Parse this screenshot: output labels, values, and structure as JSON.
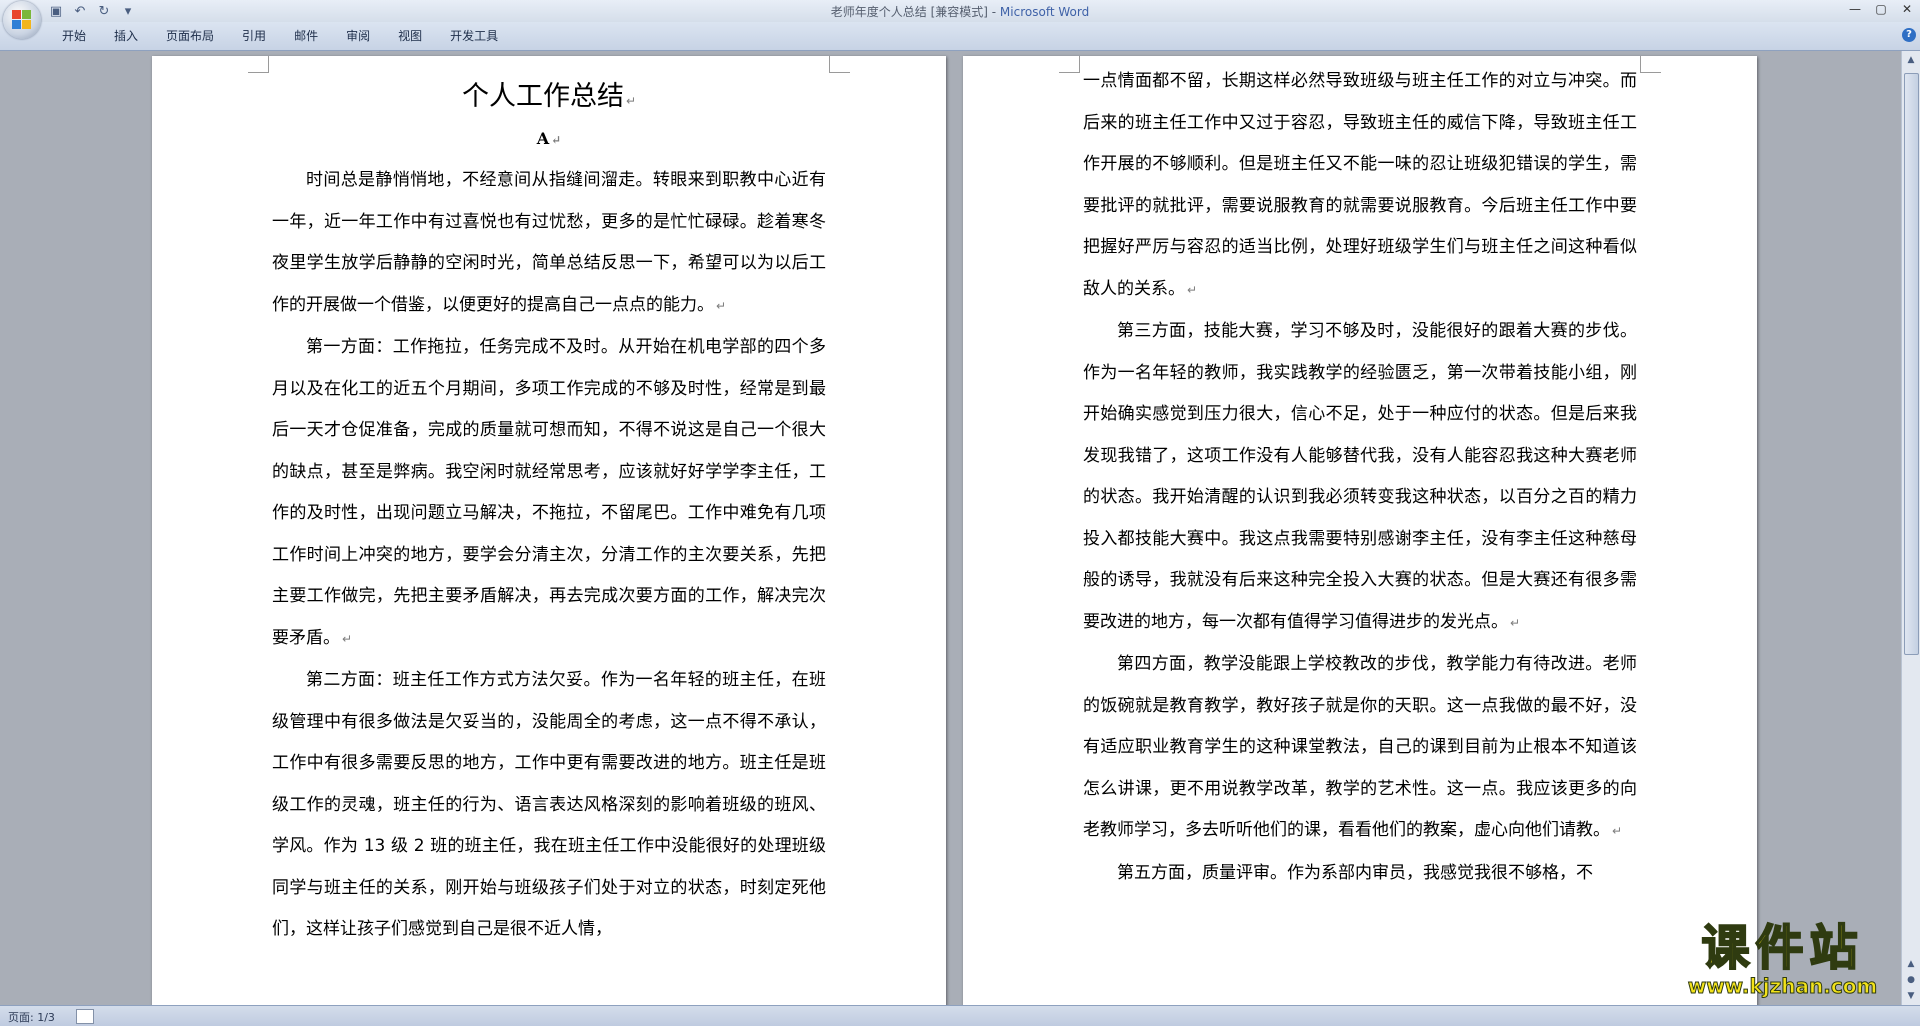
{
  "window": {
    "title": "老师年度个人总结 [兼容模式] - ",
    "app_name": "Microsoft Word",
    "minimize": "—",
    "maximize": "▢",
    "close": "✕"
  },
  "qat": {
    "save": "▣",
    "undo": "↶",
    "redo": "↻",
    "customize": "▾"
  },
  "ribbon": {
    "tabs": [
      "开始",
      "插入",
      "页面布局",
      "引用",
      "邮件",
      "审阅",
      "视图",
      "开发工具"
    ],
    "help": "?"
  },
  "page_left": {
    "title": "个人工作总结",
    "subtitle": "A",
    "paragraphs": [
      "时间总是静悄悄地，不经意间从指缝间溜走。转眼来到职教中心近有一年，近一年工作中有过喜悦也有过忧愁，更多的是忙忙碌碌。趁着寒冬夜里学生放学后静静的空闲时光，简单总结反思一下，希望可以为以后工作的开展做一个借鉴，以便更好的提高自己一点点的能力。",
      "第一方面：工作拖拉，任务完成不及时。从开始在机电学部的四个多月以及在化工的近五个月期间，多项工作完成的不够及时性，经常是到最后一天才仓促准备，完成的质量就可想而知，不得不说这是自己一个很大的缺点，甚至是弊病。我空闲时就经常思考，应该就好好学学李主任，工作的及时性，出现问题立马解决，不拖拉，不留尾巴。工作中难免有几项工作时间上冲突的地方，要学会分清主次，分清工作的主次要关系，先把主要工作做完，先把主要矛盾解决，再去完成次要方面的工作，解决完次要矛盾。",
      "第二方面：班主任工作方式方法欠妥。作为一名年轻的班主任，在班级管理中有很多做法是欠妥当的，没能周全的考虑，这一点不得不承认，工作中有很多需要反思的地方，工作中更有需要改进的地方。班主任是班级工作的灵魂，班主任的行为、语言表达风格深刻的影响着班级的班风、学风。作为 13 级 2 班的班主任，我在班主任工作中没能很好的处理班级同学与班主任的关系，刚开始与班级孩子们处于对立的状态，时刻定死他们，这样让孩子们感觉到自己是很不近人情，"
    ]
  },
  "page_right": {
    "paragraphs": [
      {
        "continued": true,
        "text": "一点情面都不留，长期这样必然导致班级与班主任工作的对立与冲突。而后来的班主任工作中又过于容忍，导致班主任的威信下降，导致班主任工作开展的不够顺利。但是班主任又不能一味的忍让班级犯错误的学生，需要批评的就批评，需要说服教育的就需要说服教育。今后班主任工作中要把握好严厉与容忍的适当比例，处理好班级学生们与班主任之间这种看似敌人的关系。"
      },
      {
        "continued": false,
        "text": "第三方面，技能大赛，学习不够及时，没能很好的跟着大赛的步伐。作为一名年轻的教师，我实践教学的经验匮乏，第一次带着技能小组，刚开始确实感觉到压力很大，信心不足，处于一种应付的状态。但是后来我发现我错了，这项工作没有人能够替代我，没有人能容忍我这种大赛老师的状态。我开始清醒的认识到我必须转变我这种状态，以百分之百的精力投入都技能大赛中。我这点我需要特别感谢李主任，没有李主任这种慈母般的诱导，我就没有后来这种完全投入大赛的状态。但是大赛还有很多需要改进的地方，每一次都有值得学习值得进步的发光点。"
      },
      {
        "continued": false,
        "text": "第四方面，教学没能跟上学校教改的步伐，教学能力有待改进。老师的饭碗就是教育教学，教好孩子就是你的天职。这一点我做的最不好，没有适应职业教育学生的这种课堂教法，自己的课到目前为止根本不知道该怎么讲课，更不用说教学改革，教学的艺术性。这一点。我应该更多的向老教师学习，多去听听他们的课，看看他们的教案，虚心向他们请教。"
      },
      {
        "continued": false,
        "text": "第五方面，质量评审。作为系部内审员，我感觉我很不够格，不"
      }
    ]
  },
  "paragraph_mark": "↵",
  "status": {
    "page": "页面: 1/3"
  },
  "watermark": {
    "cn": "课件站",
    "url": "www.kjzhan.com"
  }
}
